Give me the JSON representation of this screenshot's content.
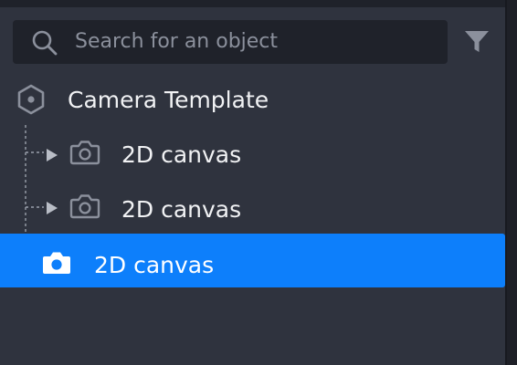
{
  "search": {
    "placeholder": "Search for an object",
    "icon": "search-icon"
  },
  "filter": {
    "icon": "filter-icon"
  },
  "tree": {
    "root": {
      "label": "Camera Template",
      "icon": "hexagon-icon"
    },
    "children": [
      {
        "label": "2D canvas",
        "icon": "camera-icon",
        "expandable": true,
        "selected": false
      },
      {
        "label": "2D canvas",
        "icon": "camera-icon",
        "expandable": true,
        "selected": false
      },
      {
        "label": "2D canvas",
        "icon": "camera-icon",
        "expandable": false,
        "selected": true
      }
    ]
  },
  "colors": {
    "panel_bg": "#2f333e",
    "input_bg": "#1f222a",
    "selection": "#0d7ffb",
    "text": "#f1f2f4",
    "muted": "#8b909c"
  }
}
